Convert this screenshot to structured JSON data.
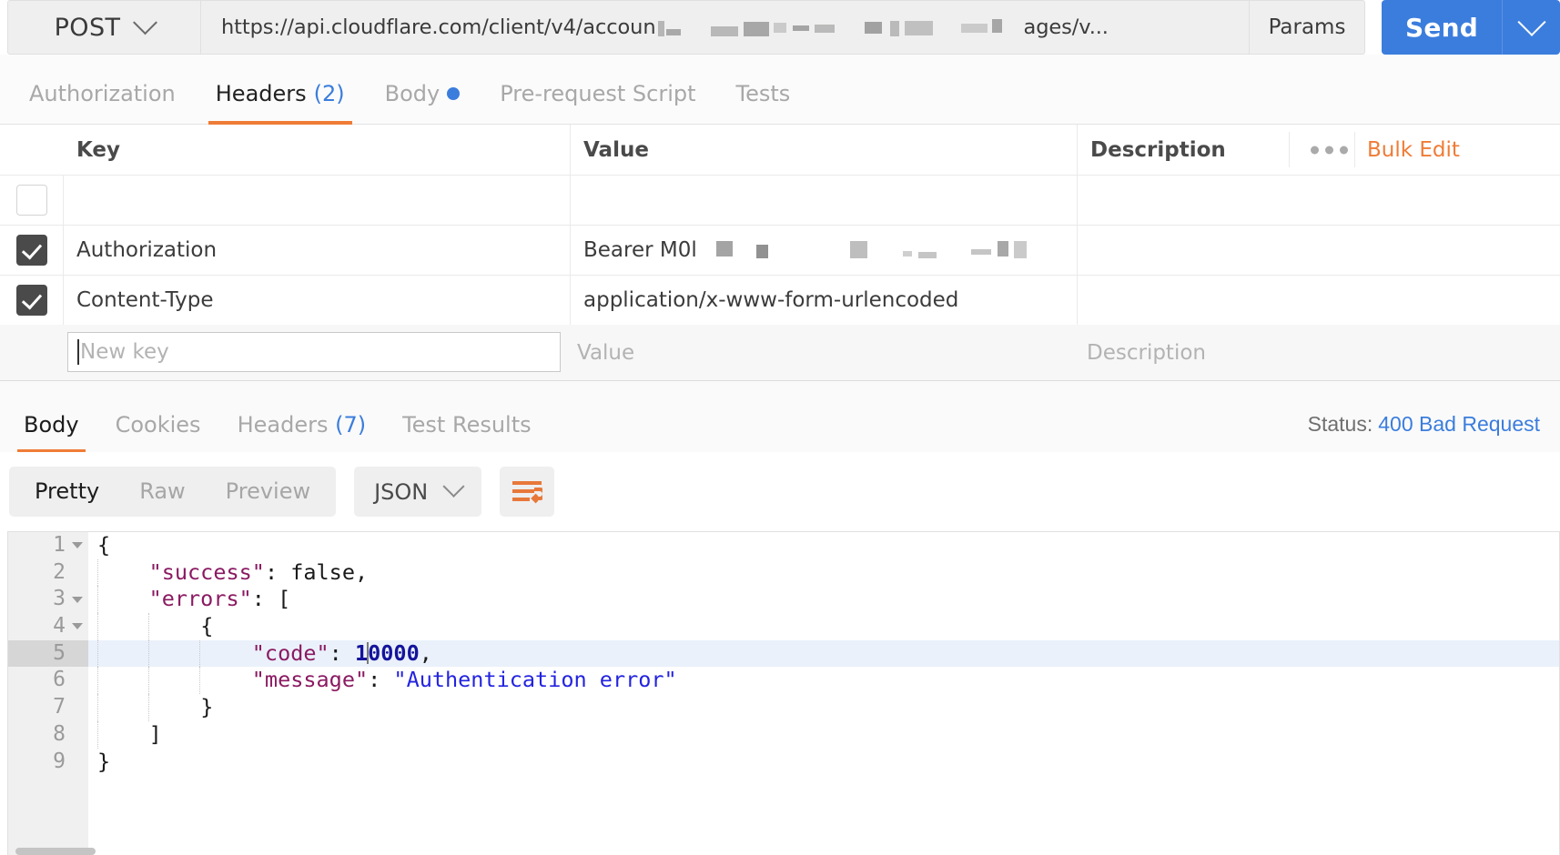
{
  "request_bar": {
    "method": "POST",
    "method_caret_icon": "chevron-down-icon",
    "url": "https://api.cloudflare.com/client/v4/accoun",
    "url_suffix": "ages/v...",
    "url_redacted": true,
    "params_label": "Params",
    "send_label": "Send",
    "send_caret_icon": "chevron-down-icon"
  },
  "request_tabs": [
    {
      "label": "Authorization",
      "active": false,
      "count": "",
      "dot": false
    },
    {
      "label": "Headers",
      "active": true,
      "count": "(2)",
      "dot": false
    },
    {
      "label": "Body",
      "active": false,
      "count": "",
      "dot": true
    },
    {
      "label": "Pre-request Script",
      "active": false,
      "count": "",
      "dot": false
    },
    {
      "label": "Tests",
      "active": false,
      "count": "",
      "dot": false
    }
  ],
  "headers_table": {
    "columns": [
      "Key",
      "Value",
      "Description"
    ],
    "more_icon": "ellipsis-icon",
    "bulk_edit_label": "Bulk Edit",
    "rows": [
      {
        "checked": false,
        "key": "",
        "value": "",
        "description": "",
        "redacted": false
      },
      {
        "checked": true,
        "key": "Authorization",
        "value": "Bearer M0l",
        "description": "",
        "redacted": true
      },
      {
        "checked": true,
        "key": "Content-Type",
        "value": "application/x-www-form-urlencoded",
        "description": "",
        "redacted": false
      }
    ],
    "new_row": {
      "key_placeholder": "New key",
      "value_placeholder": "Value",
      "description_placeholder": "Description"
    }
  },
  "response_tabs": [
    {
      "label": "Body",
      "active": true,
      "count": ""
    },
    {
      "label": "Cookies",
      "active": false,
      "count": ""
    },
    {
      "label": "Headers",
      "active": false,
      "count": "(7)"
    },
    {
      "label": "Test Results",
      "active": false,
      "count": ""
    }
  ],
  "status": {
    "label": "Status:",
    "value": "400 Bad Request"
  },
  "body_toolbar": {
    "view_modes": [
      {
        "label": "Pretty",
        "active": true
      },
      {
        "label": "Raw",
        "active": false
      },
      {
        "label": "Preview",
        "active": false
      }
    ],
    "format": "JSON",
    "format_caret_icon": "chevron-down-icon",
    "wrap_icon": "word-wrap-icon"
  },
  "code": {
    "lines": [
      {
        "num": "1",
        "foldable": true,
        "active": false,
        "indent": 0,
        "tokens": [
          {
            "t": "{",
            "c": "punc"
          }
        ]
      },
      {
        "num": "2",
        "foldable": false,
        "active": false,
        "indent": 1,
        "tokens": [
          {
            "t": "\"success\"",
            "c": "key"
          },
          {
            "t": ": ",
            "c": "punc"
          },
          {
            "t": "false",
            "c": "bool"
          },
          {
            "t": ",",
            "c": "punc"
          }
        ]
      },
      {
        "num": "3",
        "foldable": true,
        "active": false,
        "indent": 1,
        "tokens": [
          {
            "t": "\"errors\"",
            "c": "key"
          },
          {
            "t": ": ",
            "c": "punc"
          },
          {
            "t": "[",
            "c": "punc"
          }
        ]
      },
      {
        "num": "4",
        "foldable": true,
        "active": false,
        "indent": 2,
        "tokens": [
          {
            "t": "{",
            "c": "punc"
          }
        ]
      },
      {
        "num": "5",
        "foldable": false,
        "active": true,
        "indent": 3,
        "tokens": [
          {
            "t": "\"code\"",
            "c": "key"
          },
          {
            "t": ": ",
            "c": "punc"
          },
          {
            "t": "1",
            "c": "num"
          },
          {
            "t": "",
            "c": "caret"
          },
          {
            "t": "0000",
            "c": "num"
          },
          {
            "t": ",",
            "c": "punc"
          }
        ]
      },
      {
        "num": "6",
        "foldable": false,
        "active": false,
        "indent": 3,
        "tokens": [
          {
            "t": "\"message\"",
            "c": "key"
          },
          {
            "t": ": ",
            "c": "punc"
          },
          {
            "t": "\"Authentication error\"",
            "c": "str"
          }
        ]
      },
      {
        "num": "7",
        "foldable": false,
        "active": false,
        "indent": 2,
        "tokens": [
          {
            "t": "}",
            "c": "punc"
          }
        ]
      },
      {
        "num": "8",
        "foldable": false,
        "active": false,
        "indent": 1,
        "tokens": [
          {
            "t": "]",
            "c": "punc"
          }
        ]
      },
      {
        "num": "9",
        "foldable": false,
        "active": false,
        "indent": 0,
        "tokens": [
          {
            "t": "}",
            "c": "punc"
          }
        ]
      }
    ]
  },
  "colors": {
    "accent_orange": "#ef7c36",
    "accent_blue": "#3b7ddd",
    "json_key": "#8b1a62",
    "json_string": "#2323e0",
    "json_number": "#14149b"
  }
}
